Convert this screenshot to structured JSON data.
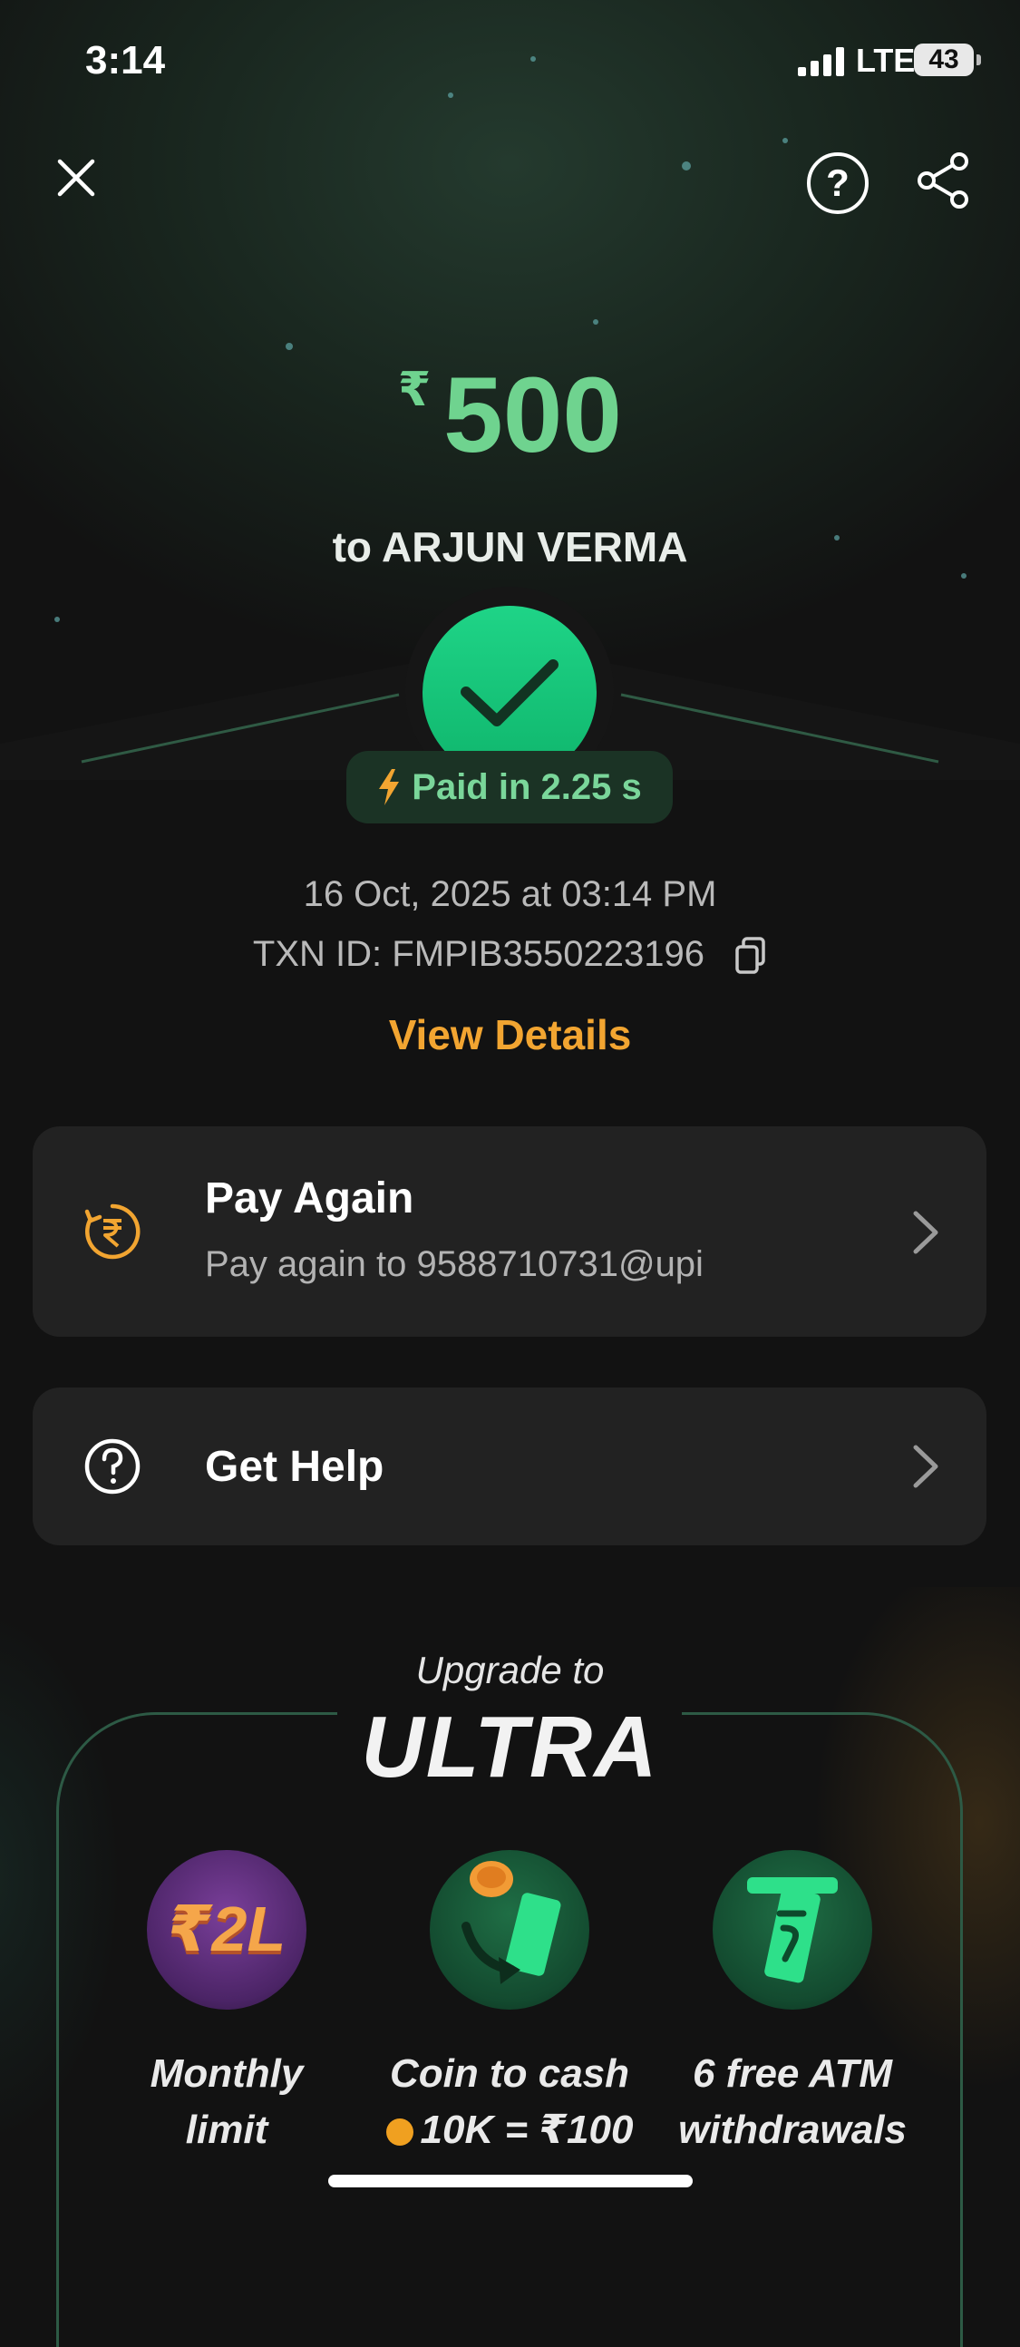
{
  "status_bar": {
    "time": "3:14",
    "network": "LTE",
    "battery": "43"
  },
  "header": {
    "close_icon": "close-icon",
    "help_icon": "help-icon",
    "share_icon": "share-icon"
  },
  "payment": {
    "currency_symbol": "₹",
    "amount": "500",
    "recipient_line": "to ARJUN VERMA",
    "paid_time": "Paid in 2.25 s",
    "datetime": "16 Oct, 2025 at 03:14 PM",
    "txn_id": "TXN ID: FMPIB3550223196",
    "view_details": "View Details"
  },
  "actions": {
    "pay_again": {
      "title": "Pay Again",
      "subtitle": "Pay again to 9588710731@upi"
    },
    "get_help": {
      "title": "Get Help"
    }
  },
  "upgrade": {
    "prefix": "Upgrade to",
    "brand": "ULTRA",
    "badge_text": "₹2L",
    "benefits": [
      {
        "line1": "Monthly",
        "line2": "limit"
      },
      {
        "line1": "Coin to cash",
        "line2": "10K = ₹100"
      },
      {
        "line1": "6 free ATM",
        "line2": "withdrawals"
      }
    ]
  },
  "colors": {
    "accent_green": "#6fd38f",
    "success": "#1fd487",
    "link_orange": "#f2a531",
    "card_bg": "#222222"
  }
}
